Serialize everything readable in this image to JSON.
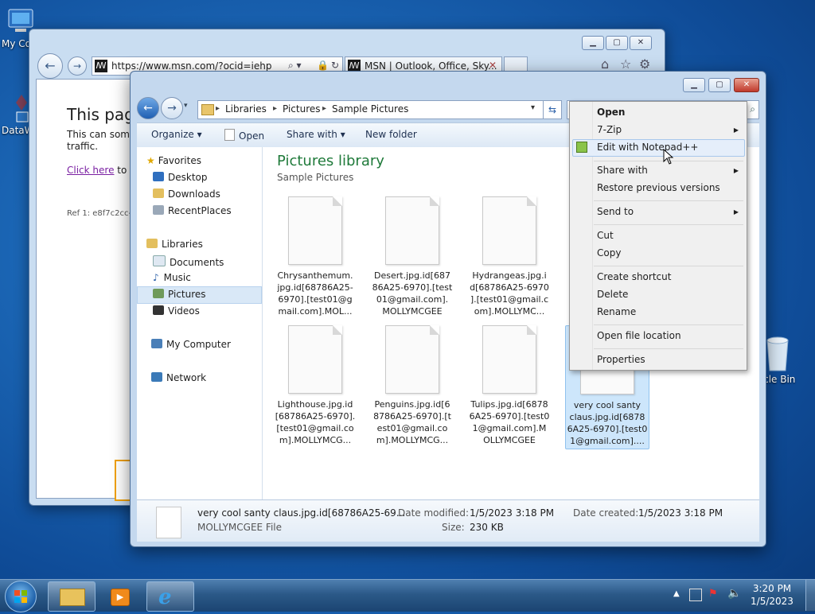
{
  "desktop": {
    "icons": [
      {
        "label": "My Co"
      },
      {
        "label": "DataW"
      },
      {
        "label": "ycle Bin"
      }
    ]
  },
  "browser": {
    "url": "https://www.msn.com/?ocid=iehp",
    "tab_title": "MSN | Outlook, Office, Sky...",
    "heading": "This page",
    "text_line1": "This can some",
    "text_line2": "traffic.",
    "link": "Click here",
    "link_suffix": "to t",
    "ref": "Ref 1: e8f7c2cc-"
  },
  "explorer": {
    "breadcrumb": [
      "Libraries",
      "Pictures",
      "Sample Pictures"
    ],
    "toolbar": {
      "organize": "Organize",
      "open": "Open",
      "share_with": "Share with",
      "new_folder": "New folder"
    },
    "nav": {
      "favorites": "Favorites",
      "desktop": "Desktop",
      "downloads": "Downloads",
      "recent": "RecentPlaces",
      "libraries": "Libraries",
      "documents": "Documents",
      "music": "Music",
      "pictures": "Pictures",
      "videos": "Videos",
      "computer": "My Computer",
      "network": "Network"
    },
    "library_title": "Pictures library",
    "library_subtitle": "Sample Pictures",
    "files": [
      {
        "l1": "Chrysanthemum.",
        "l2": "jpg.id[68786A25-",
        "l3": "6970].[test01@g",
        "l4": "mail.com].MOL..."
      },
      {
        "l1": "Desert.jpg.id[687",
        "l2": "86A25-6970].[test",
        "l3": "01@gmail.com].",
        "l4": "MOLLYMCGEE"
      },
      {
        "l1": "Hydrangeas.jpg.i",
        "l2": "d[68786A25-6970",
        "l3": "].[test01@gmail.c",
        "l4": "om].MOLLYMC..."
      },
      {
        "l1": "Lighthouse.jpg.id",
        "l2": "[68786A25-6970].",
        "l3": "[test01@gmail.co",
        "l4": "m].MOLLYMCG..."
      },
      {
        "l1": "Penguins.jpg.id[6",
        "l2": "8786A25-6970].[t",
        "l3": "est01@gmail.co",
        "l4": "m].MOLLYMCG..."
      },
      {
        "l1": "Tulips.jpg.id[6878",
        "l2": "6A25-6970].[test0",
        "l3": "1@gmail.com].M",
        "l4": "OLLYMCGEE"
      },
      {
        "l1": "very cool santy",
        "l2": "claus.jpg.id[6878",
        "l3": "6A25-6970].[test0",
        "l4": "1@gmail.com]...."
      }
    ],
    "details": {
      "name": "very cool santy claus.jpg.id[68786A25-69...",
      "type": "MOLLYMCGEE File",
      "modified_label": "Date modified:",
      "modified": "1/5/2023 3:18 PM",
      "size_label": "Size:",
      "size": "230 KB",
      "created_label": "Date created:",
      "created": "1/5/2023 3:18 PM"
    }
  },
  "context_menu": {
    "open": "Open",
    "zip": "7-Zip",
    "notepad": "Edit with Notepad++",
    "share": "Share with",
    "restore": "Restore previous versions",
    "send_to": "Send to",
    "cut": "Cut",
    "copy": "Copy",
    "shortcut": "Create shortcut",
    "delete": "Delete",
    "rename": "Rename",
    "open_location": "Open file location",
    "properties": "Properties"
  },
  "taskbar": {
    "time": "3:20 PM",
    "date": "1/5/2023"
  },
  "colors": {
    "accent_green": "#1f7a3a",
    "selection": "#cde6fb"
  }
}
